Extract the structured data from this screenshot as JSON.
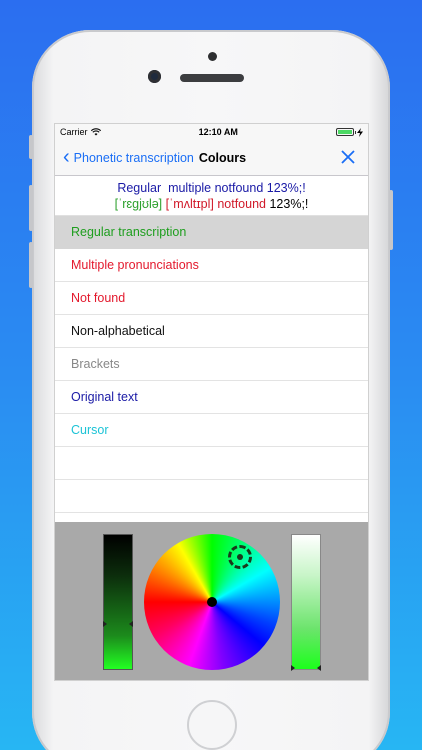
{
  "status": {
    "carrier": "Carrier",
    "time": "12:10 AM"
  },
  "nav": {
    "back_label": "Phonetic transcription",
    "title": "Colours"
  },
  "preview": {
    "line1": [
      {
        "text": "Regular  ",
        "color": "#1a1aa6"
      },
      {
        "text": "multiple ",
        "color": "#1a1aa6"
      },
      {
        "text": "notfound ",
        "color": "#1a1aa6"
      },
      {
        "text": "123%;!",
        "color": "#1a1aa6"
      }
    ],
    "line2": [
      {
        "text": "[ˈrɛɡjʊlə]",
        "color": "#2ca02c"
      },
      {
        "text": " ",
        "color": "#000000"
      },
      {
        "text": "[ˈmʌltɪpl]",
        "color": "#d11a2a"
      },
      {
        "text": " notfound ",
        "color": "#d11a2a"
      },
      {
        "text": "123%;!",
        "color": "#000000"
      }
    ]
  },
  "rows": [
    {
      "label": "Regular transcription",
      "color": "#1e9e1e",
      "selected": true
    },
    {
      "label": "Multiple pronunciations",
      "color": "#e3192d",
      "selected": false
    },
    {
      "label": "Not found",
      "color": "#e3192d",
      "selected": false
    },
    {
      "label": "Non-alphabetical",
      "color": "#111111",
      "selected": false
    },
    {
      "label": "Brackets",
      "color": "#888888",
      "selected": false
    },
    {
      "label": "Original text",
      "color": "#1a1aa6",
      "selected": false
    },
    {
      "label": "Cursor",
      "color": "#1cc3d6",
      "selected": false
    }
  ],
  "colors": {
    "accent": "#1a6ef5",
    "picker_bg": "#a9a9a9"
  }
}
